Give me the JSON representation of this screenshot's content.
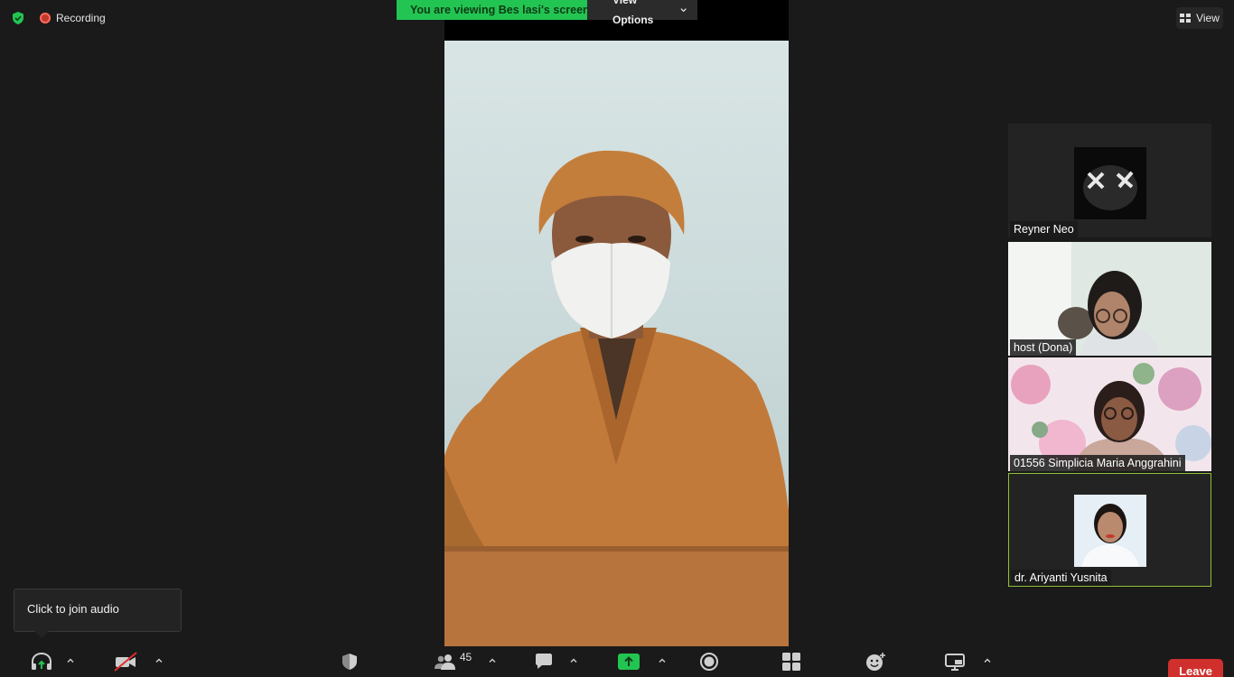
{
  "meeting": {
    "recording_label": "Recording",
    "share_banner": "You are viewing Bes lasi's screen",
    "view_options_label": "View Options",
    "view_button_label": "View"
  },
  "participants": [
    {
      "name": "Reyner Neo"
    },
    {
      "name": "host (Dona)"
    },
    {
      "name": "01556 Simplicia Maria Anggrahini"
    },
    {
      "name": "dr. Ariyanti Yusnita"
    }
  ],
  "tooltip": {
    "text": "Click to join audio"
  },
  "toolbar": {
    "participants_count": "45",
    "leave_label": "Leave"
  },
  "icons": {
    "secure": "shield-check-icon",
    "audio": "headphones-icon",
    "video": "camera-off-icon",
    "security": "security-shield-icon",
    "participants": "people-icon",
    "chat": "chat-bubble-icon",
    "share": "share-screen-icon",
    "record": "record-icon",
    "apps": "apps-grid-icon",
    "reactions": "emoji-icon",
    "whiteboard": "whiteboard-icon"
  },
  "colors": {
    "accent_green": "#23c552",
    "leave_red": "#d0302d",
    "active_border": "#8fbf3a",
    "background": "#1a1a1a"
  }
}
